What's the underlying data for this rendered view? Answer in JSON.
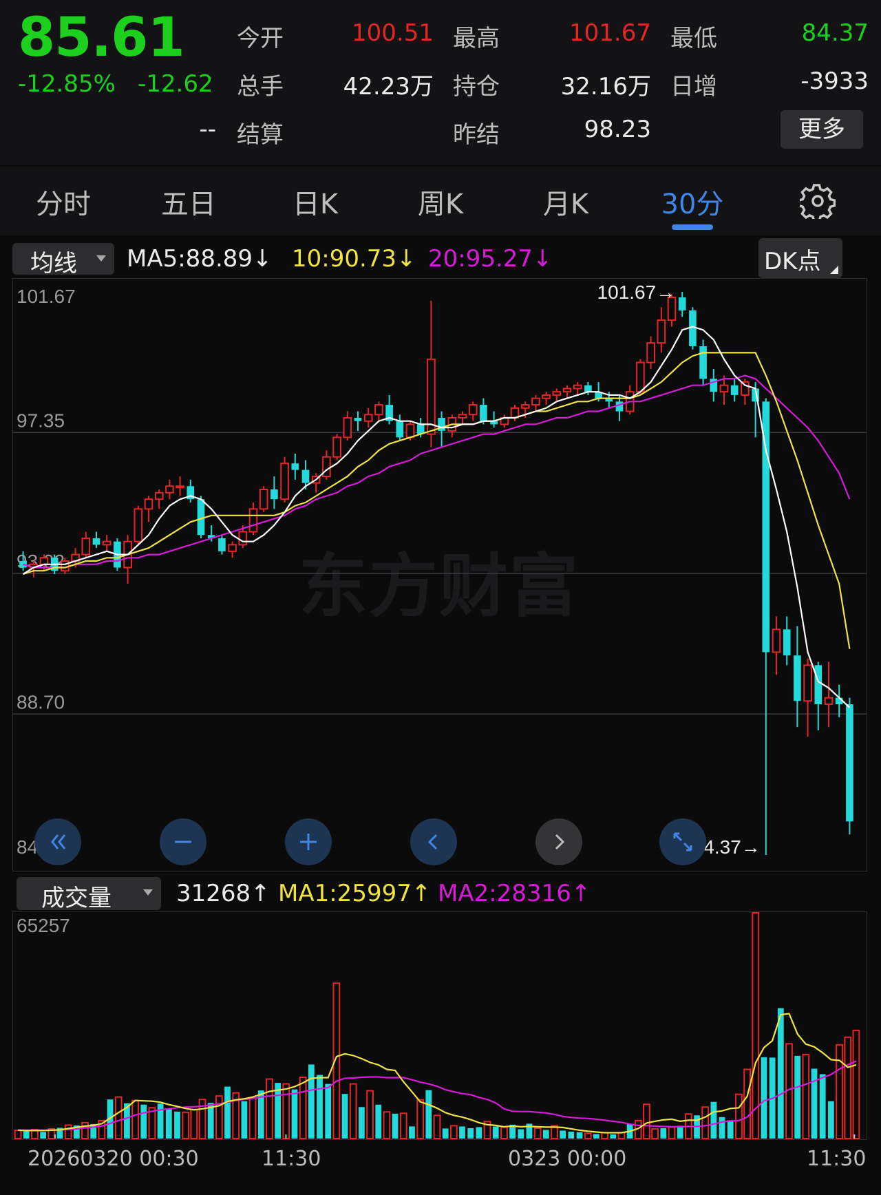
{
  "quote": {
    "price": "85.61",
    "change_pct": "-12.85%",
    "change": "-12.62",
    "fields": [
      {
        "label": "今开",
        "value": "100.51",
        "color": "#e62626"
      },
      {
        "label": "最高",
        "value": "101.67",
        "color": "#e62626"
      },
      {
        "label": "最低",
        "value": "84.37",
        "color": "#1ed01e"
      },
      {
        "label": "总手",
        "value": "42.23万",
        "color": "#ececec"
      },
      {
        "label": "持仓",
        "value": "32.16万",
        "color": "#ececec"
      },
      {
        "label": "日增",
        "value": "-3933",
        "color": "#ececec"
      },
      {
        "label": "结算",
        "value": "--",
        "color": "#ececec"
      },
      {
        "label": "昨结",
        "value": "98.23",
        "color": "#ececec"
      }
    ],
    "more_label": "更多"
  },
  "tabs": [
    "分时",
    "五日",
    "日K",
    "周K",
    "月K",
    "30分"
  ],
  "active_tab": "30分",
  "indicator": {
    "select_label": "均线",
    "ma5": "MA5:88.89",
    "ma10": "10:90.73",
    "ma20": "20:95.27",
    "ma5_color": "#ffffff",
    "ma10_color": "#f0e442",
    "ma20_color": "#d81bd8",
    "dk_label": "DK点"
  },
  "volume_indicator": {
    "select_label": "成交量",
    "vol": "31268",
    "ma1": "MA1:25997",
    "ma2": "MA2:28316"
  },
  "watermark": "东方财富",
  "colors": {
    "up": "#e62626",
    "down": "#23d9d9",
    "accent": "#3f86e6"
  },
  "controls": [
    "double-left-icon",
    "minus-icon",
    "plus-icon",
    "left-icon",
    "right-icon",
    "expand-icon"
  ],
  "chart_data": [
    {
      "type": "candlestick",
      "title": "",
      "y_ticks": [
        "101.67",
        "97.35",
        "93.02",
        "88.70",
        "84.37"
      ],
      "ylim": [
        84.37,
        101.67
      ],
      "max_marker": "101.67→",
      "min_marker": "84.37→",
      "x_ticks": [
        "20260320 00:30",
        "11:30",
        "0323 00:00",
        "11:30"
      ],
      "ohlc": [
        [
          93.4,
          93.7,
          93.1,
          93.2
        ],
        [
          93.2,
          93.4,
          92.9,
          93.3
        ],
        [
          93.3,
          93.6,
          93.1,
          93.5
        ],
        [
          93.5,
          93.6,
          93.0,
          93.1
        ],
        [
          93.1,
          93.5,
          93.0,
          93.4
        ],
        [
          93.4,
          93.8,
          93.2,
          93.6
        ],
        [
          93.6,
          94.3,
          93.5,
          94.1
        ],
        [
          94.1,
          94.3,
          93.8,
          93.9
        ],
        [
          93.9,
          94.2,
          93.7,
          94.0
        ],
        [
          94.0,
          94.1,
          93.1,
          93.2
        ],
        [
          93.2,
          94.2,
          92.7,
          94.0
        ],
        [
          94.0,
          95.1,
          93.9,
          95.0
        ],
        [
          95.0,
          95.4,
          94.6,
          95.3
        ],
        [
          95.3,
          95.6,
          95.0,
          95.5
        ],
        [
          95.5,
          95.9,
          95.3,
          95.7
        ],
        [
          95.7,
          96.0,
          95.4,
          95.7
        ],
        [
          95.7,
          95.9,
          95.2,
          95.3
        ],
        [
          95.3,
          95.4,
          94.1,
          94.2
        ],
        [
          94.2,
          94.5,
          94.0,
          94.1
        ],
        [
          94.1,
          94.2,
          93.6,
          93.7
        ],
        [
          93.7,
          94.0,
          93.5,
          93.9
        ],
        [
          93.9,
          94.5,
          93.8,
          94.3
        ],
        [
          94.3,
          95.2,
          94.2,
          95.0
        ],
        [
          95.0,
          95.7,
          94.9,
          95.6
        ],
        [
          95.6,
          96.0,
          95.0,
          95.3
        ],
        [
          95.3,
          96.6,
          95.2,
          96.4
        ],
        [
          96.4,
          96.7,
          95.9,
          96.2
        ],
        [
          96.2,
          96.5,
          95.6,
          95.8
        ],
        [
          95.8,
          96.1,
          95.5,
          96.0
        ],
        [
          96.0,
          96.8,
          95.9,
          96.6
        ],
        [
          96.6,
          97.3,
          96.5,
          97.2
        ],
        [
          97.2,
          98.0,
          97.1,
          97.8
        ],
        [
          97.8,
          98.0,
          97.4,
          97.7
        ],
        [
          97.7,
          98.1,
          97.5,
          97.9
        ],
        [
          97.9,
          98.3,
          97.7,
          98.2
        ],
        [
          98.2,
          98.5,
          97.6,
          97.7
        ],
        [
          97.7,
          97.9,
          97.1,
          97.2
        ],
        [
          97.2,
          97.7,
          97.1,
          97.6
        ],
        [
          97.6,
          97.8,
          97.2,
          97.3
        ],
        [
          97.3,
          101.4,
          96.9,
          99.6
        ],
        [
          97.8,
          98.0,
          96.9,
          97.4
        ],
        [
          97.4,
          97.9,
          97.2,
          97.8
        ],
        [
          97.8,
          98.0,
          97.6,
          97.9
        ],
        [
          97.9,
          98.3,
          97.7,
          98.2
        ],
        [
          98.2,
          98.4,
          97.6,
          97.7
        ],
        [
          97.7,
          98.0,
          97.5,
          97.6
        ],
        [
          97.6,
          97.9,
          97.5,
          97.8
        ],
        [
          97.8,
          98.2,
          97.7,
          98.1
        ],
        [
          98.1,
          98.3,
          97.8,
          98.2
        ],
        [
          98.2,
          98.5,
          98.0,
          98.4
        ],
        [
          98.4,
          98.6,
          98.2,
          98.5
        ],
        [
          98.5,
          98.7,
          98.3,
          98.6
        ],
        [
          98.6,
          98.8,
          98.4,
          98.7
        ],
        [
          98.7,
          98.9,
          98.5,
          98.8
        ],
        [
          98.8,
          98.9,
          98.5,
          98.6
        ],
        [
          98.6,
          98.9,
          98.3,
          98.4
        ],
        [
          98.4,
          98.6,
          98.1,
          98.3
        ],
        [
          98.3,
          98.5,
          97.7,
          98.0
        ],
        [
          98.0,
          98.8,
          97.9,
          98.6
        ],
        [
          98.6,
          99.6,
          98.5,
          99.5
        ],
        [
          99.5,
          100.3,
          99.3,
          100.1
        ],
        [
          100.1,
          101.2,
          99.8,
          100.8
        ],
        [
          100.8,
          101.6,
          100.6,
          101.5
        ],
        [
          101.5,
          101.67,
          100.9,
          101.1
        ],
        [
          101.1,
          101.2,
          99.9,
          100.0
        ],
        [
          100.0,
          100.2,
          98.8,
          99.0
        ],
        [
          99.0,
          99.3,
          98.3,
          98.6
        ],
        [
          98.6,
          99.1,
          98.2,
          98.8
        ],
        [
          98.8,
          99.0,
          98.3,
          98.5
        ],
        [
          98.5,
          99.0,
          98.2,
          98.9
        ],
        [
          98.7,
          98.9,
          97.2,
          98.3
        ],
        [
          98.3,
          98.4,
          84.37,
          90.6
        ],
        [
          90.6,
          91.7,
          89.9,
          91.3
        ],
        [
          91.3,
          91.7,
          90.2,
          90.5
        ],
        [
          90.5,
          91.4,
          88.3,
          89.1
        ],
        [
          89.1,
          90.4,
          88.0,
          90.2
        ],
        [
          90.2,
          90.3,
          88.2,
          89.0
        ],
        [
          89.0,
          90.3,
          88.3,
          89.2
        ],
        [
          89.2,
          89.6,
          88.6,
          89.0
        ],
        [
          89.0,
          89.2,
          85.0,
          85.4
        ]
      ],
      "ma5": [
        93.0,
        93.2,
        93.3,
        93.3,
        93.3,
        93.4,
        93.5,
        93.6,
        93.7,
        93.6,
        93.6,
        93.9,
        94.2,
        94.7,
        95.1,
        95.3,
        95.4,
        95.3,
        95.0,
        94.6,
        94.2,
        94.0,
        94.0,
        94.2,
        94.5,
        94.9,
        95.4,
        95.7,
        95.9,
        96.2,
        96.4,
        96.7,
        97.1,
        97.4,
        97.7,
        97.8,
        97.7,
        97.7,
        97.6,
        97.6,
        97.5,
        97.5,
        97.6,
        97.6,
        97.7,
        97.7,
        97.8,
        97.8,
        97.9,
        98.0,
        98.1,
        98.3,
        98.4,
        98.5,
        98.6,
        98.6,
        98.5,
        98.5,
        98.4,
        98.6,
        98.9,
        99.4,
        99.9,
        100.5,
        100.6,
        100.5,
        100.2,
        99.6,
        99.1,
        98.8,
        98.7,
        96.8,
        95.6,
        94.3,
        92.6,
        90.6,
        89.7,
        89.5,
        89.2,
        88.9
      ],
      "ma10": [
        93.0,
        93.1,
        93.1,
        93.2,
        93.2,
        93.3,
        93.4,
        93.4,
        93.5,
        93.5,
        93.6,
        93.7,
        93.8,
        94.0,
        94.2,
        94.4,
        94.6,
        94.7,
        94.8,
        94.8,
        94.8,
        94.8,
        94.8,
        94.8,
        94.8,
        94.9,
        95.1,
        95.2,
        95.4,
        95.6,
        95.8,
        96.0,
        96.3,
        96.5,
        96.8,
        97.0,
        97.1,
        97.2,
        97.3,
        97.4,
        97.5,
        97.6,
        97.6,
        97.6,
        97.7,
        97.7,
        97.8,
        97.8,
        97.9,
        98.0,
        98.0,
        98.1,
        98.2,
        98.3,
        98.3,
        98.4,
        98.4,
        98.4,
        98.4,
        98.5,
        98.7,
        98.9,
        99.2,
        99.5,
        99.7,
        99.8,
        99.8,
        99.8,
        99.8,
        99.8,
        99.8,
        99.1,
        98.3,
        97.4,
        96.5,
        95.5,
        94.5,
        93.6,
        92.7,
        90.7
      ],
      "ma20": [
        93.3,
        93.2,
        93.2,
        93.2,
        93.2,
        93.3,
        93.3,
        93.3,
        93.4,
        93.4,
        93.5,
        93.5,
        93.6,
        93.6,
        93.7,
        93.8,
        93.9,
        94.0,
        94.1,
        94.2,
        94.3,
        94.4,
        94.5,
        94.6,
        94.7,
        94.8,
        95.0,
        95.1,
        95.3,
        95.4,
        95.5,
        95.7,
        95.8,
        96.0,
        96.1,
        96.3,
        96.4,
        96.5,
        96.7,
        96.8,
        96.9,
        97.0,
        97.1,
        97.2,
        97.3,
        97.3,
        97.4,
        97.5,
        97.6,
        97.6,
        97.7,
        97.8,
        97.8,
        97.9,
        98.0,
        98.0,
        98.1,
        98.2,
        98.3,
        98.3,
        98.4,
        98.5,
        98.6,
        98.7,
        98.8,
        98.8,
        98.9,
        99.0,
        99.0,
        99.1,
        99.0,
        98.7,
        98.4,
        98.1,
        97.8,
        97.5,
        97.1,
        96.6,
        96.1,
        95.3
      ]
    },
    {
      "type": "bar",
      "title": "",
      "y_ticks": [
        "65257"
      ],
      "ylim": [
        0,
        65257
      ],
      "volume": [
        2400,
        2100,
        2600,
        1900,
        2800,
        3100,
        3900,
        3800,
        4600,
        4200,
        5200,
        11300,
        12000,
        10200,
        11000,
        9800,
        8900,
        10100,
        8700,
        7800,
        7600,
        8400,
        11300,
        10300,
        12300,
        15000,
        13200,
        10800,
        11700,
        13900,
        17200,
        16100,
        15800,
        14200,
        17700,
        21400,
        18400,
        15800,
        44900,
        12900,
        15800,
        9100,
        13800,
        9800,
        7700,
        7200,
        7300,
        3500,
        11200,
        14000,
        6700,
        2900,
        3700,
        3500,
        3000,
        3300,
        4900,
        3500,
        3300,
        4000,
        2700,
        4300,
        3000,
        2500,
        3700,
        2300,
        2000,
        1800,
        1500,
        1300,
        1700,
        1200,
        1700,
        4200,
        5200,
        9900,
        2800,
        3000,
        3300,
        3700,
        7100,
        6700,
        9100,
        10600,
        6200,
        5300,
        12800,
        20000,
        65257,
        23500,
        23400,
        37700,
        27400,
        23900,
        24300,
        20200,
        18600,
        10800,
        27100,
        29300,
        31268
      ],
      "ma1": [
        2400,
        2300,
        2300,
        2300,
        2400,
        2500,
        2900,
        3200,
        3600,
        3800,
        4300,
        5900,
        7500,
        9000,
        11000,
        10900,
        10800,
        10500,
        9800,
        9300,
        8700,
        8300,
        8600,
        9000,
        9500,
        10700,
        11200,
        11500,
        12000,
        12800,
        13600,
        14000,
        14300,
        15000,
        16100,
        17400,
        17600,
        17600,
        23700,
        24500,
        24000,
        23100,
        22000,
        21300,
        20000,
        19700,
        16400,
        13500,
        10600,
        9800,
        8800,
        7500,
        6700,
        6200,
        5500,
        4600,
        4000,
        3800,
        3400,
        3600,
        3400,
        3500,
        3400,
        3300,
        3300,
        3200,
        2800,
        2400,
        2100,
        1900,
        1700,
        1700,
        1700,
        2100,
        2900,
        4500,
        5000,
        5400,
        5600,
        5000,
        5300,
        5300,
        6200,
        7700,
        8000,
        8700,
        8900,
        12200,
        21900,
        26300,
        28300,
        35800,
        36100,
        30200,
        27300,
        26500,
        24800,
        22800,
        22600,
        20600,
        21300
      ],
      "ma2": [
        2400,
        2400,
        2400,
        2400,
        2400,
        2500,
        2600,
        2800,
        3100,
        3300,
        3600,
        4400,
        5200,
        5900,
        6800,
        7400,
        7900,
        8300,
        8600,
        8900,
        9100,
        9200,
        9400,
        9700,
        10000,
        10500,
        11000,
        11300,
        11600,
        12000,
        12300,
        12500,
        12800,
        13000,
        13500,
        14000,
        14400,
        14700,
        16600,
        17400,
        17500,
        17700,
        17800,
        17800,
        17600,
        17600,
        17600,
        17000,
        16300,
        15800,
        15100,
        14100,
        13500,
        13000,
        12700,
        11900,
        11300,
        10300,
        8600,
        7900,
        7800,
        7800,
        7600,
        7400,
        7000,
        6400,
        6100,
        5900,
        5800,
        5600,
        5300,
        5000,
        4700,
        4200,
        3800,
        3700,
        3600,
        3500,
        3400,
        3400,
        3500,
        3500,
        3700,
        4200,
        4800,
        5100,
        5200,
        6200,
        8700,
        10900,
        11600,
        12800,
        14200,
        14900,
        15700,
        16600,
        17600,
        18500,
        20100,
        21300,
        22400
      ]
    }
  ]
}
